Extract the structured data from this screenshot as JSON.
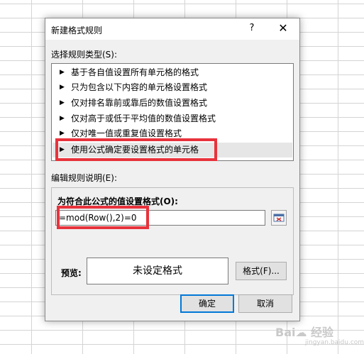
{
  "dialog": {
    "title": "新建格式规则",
    "help_label": "?",
    "close_label": "✕"
  },
  "rule_type": {
    "label": "选择规则类型(S):",
    "items": [
      {
        "label": "基于各自值设置所有单元格的格式"
      },
      {
        "label": "只为包含以下内容的单元格设置格式"
      },
      {
        "label": "仅对排名靠前或靠后的数值设置格式"
      },
      {
        "label": "仅对高于或低于平均值的数值设置格式"
      },
      {
        "label": "仅对唯一值或重复值设置格式"
      },
      {
        "label": "使用公式确定要设置格式的单元格"
      }
    ],
    "arrow_glyph": "▶",
    "selected_index": 5
  },
  "description": {
    "label": "编辑规则说明(E):",
    "formula_label": "为符合此公式的值设置格式(O):",
    "formula_value": "=mod(Row(),2)=0",
    "preview_label": "预览:",
    "preview_text": "未设定格式",
    "format_button": "格式(F)..."
  },
  "buttons": {
    "ok": "确定",
    "cancel": "取消"
  },
  "watermark": {
    "text": "Bai☁ 经验",
    "sub": "jingyan.baidu.com"
  },
  "colors": {
    "highlight_red": "#e8323c",
    "selection_gray": "#e6e6e6",
    "dialog_bg": "#f0f0f0"
  }
}
